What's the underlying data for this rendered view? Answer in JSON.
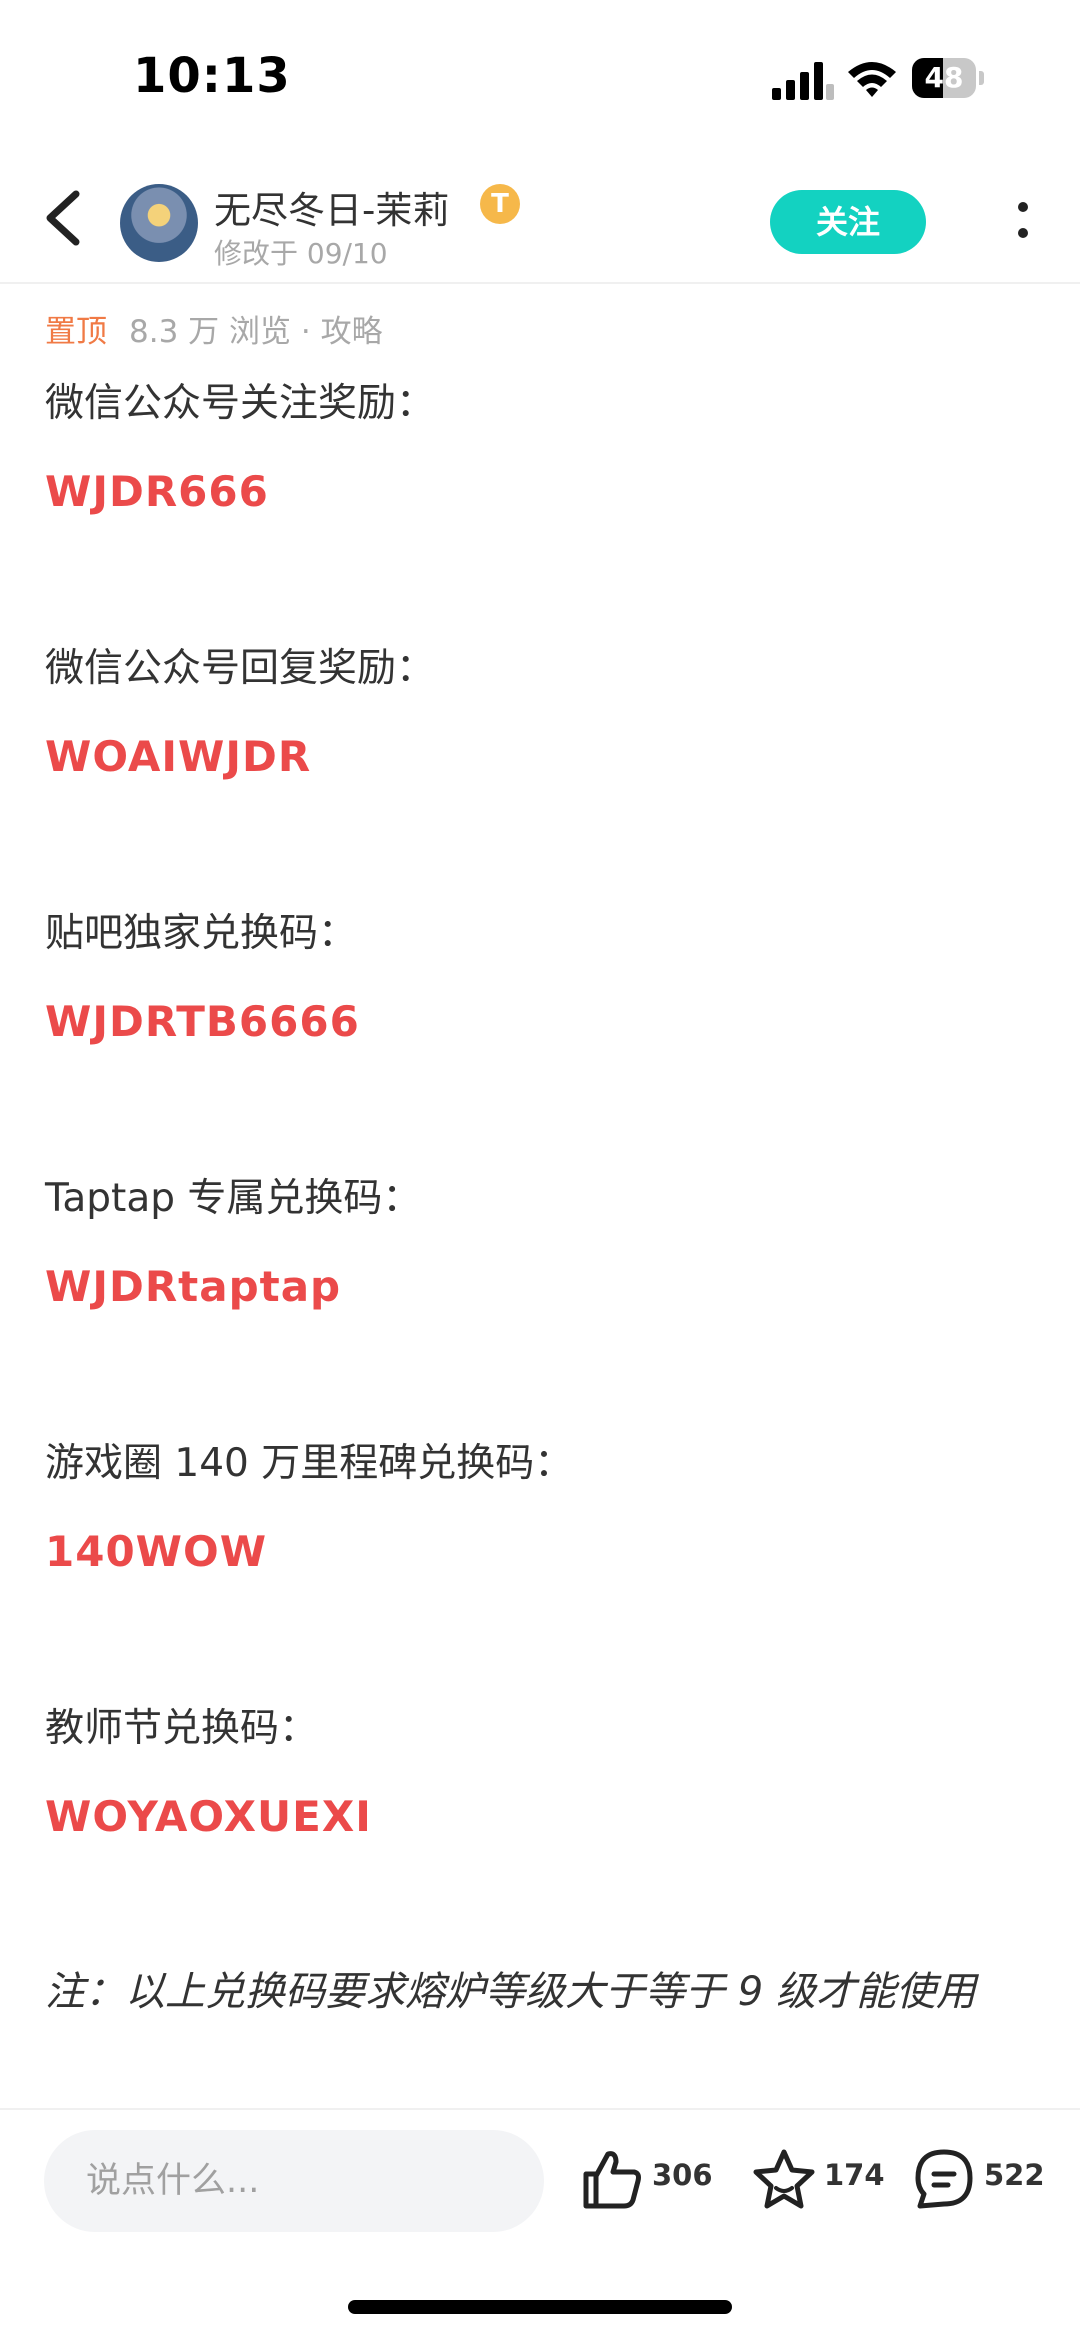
{
  "status_bar": {
    "time": "10:13",
    "battery": "48",
    "battery_level": 0.48
  },
  "header": {
    "author_name": "无尽冬日-茉莉",
    "badge_letter": "T",
    "modified": "修改于 09/10",
    "follow_label": "关注"
  },
  "post": {
    "pinned_label": "置顶",
    "views": "8.3 万 浏览 · 攻略",
    "items": [
      {
        "label": "微信公众号关注奖励：",
        "code": "WJDR666"
      },
      {
        "label": "微信公众号回复奖励：",
        "code": "WOAIWJDR"
      },
      {
        "label": "贴吧独家兑换码：",
        "code": "WJDRTB6666"
      },
      {
        "label": "Taptap 专属兑换码：",
        "code": "WJDRtaptap"
      },
      {
        "label": "游戏圈 140 万里程碑兑换码：",
        "code": "140WOW"
      },
      {
        "label": "教师节兑换码：",
        "code": "WOYAOXUEXI"
      }
    ],
    "note": "注：以上兑换码要求熔炉等级大于等于 9 级才能使用"
  },
  "bottom_bar": {
    "comment_placeholder": "说点什么...",
    "likes": "306",
    "favorites": "174",
    "comments": "522"
  },
  "colors": {
    "accent": "#13d2c1",
    "code_red": "#eb4a4a",
    "pin_orange": "#f07a45"
  },
  "icons": [
    "back-icon",
    "more-icon",
    "like-icon",
    "star-icon",
    "comment-icon",
    "signal-icon",
    "wifi-icon",
    "battery-icon"
  ]
}
